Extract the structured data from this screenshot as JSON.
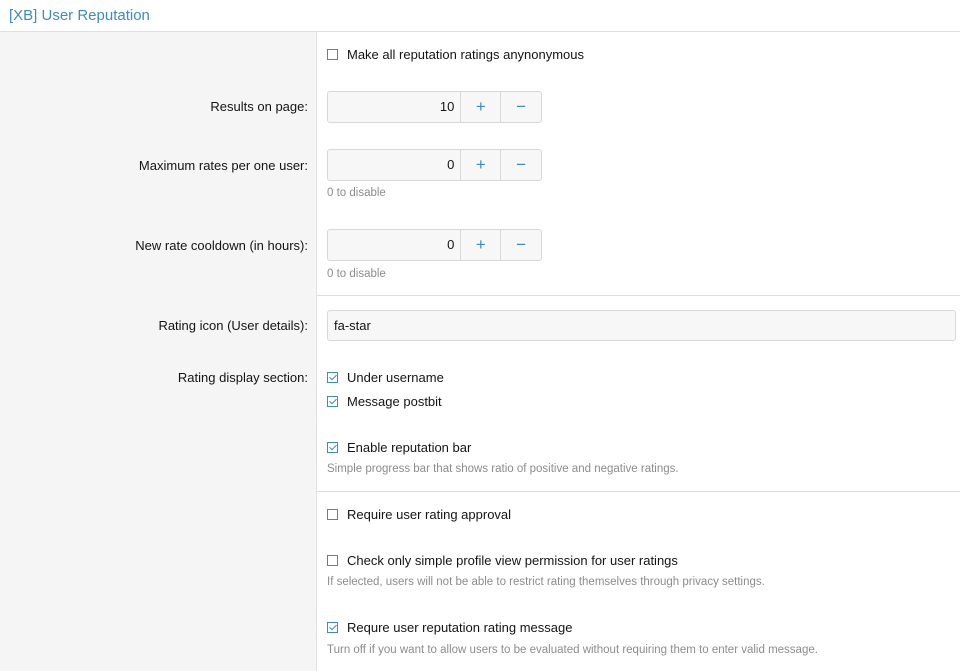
{
  "header": {
    "title": "[XB] User Reputation"
  },
  "options": {
    "anonymous": {
      "label": "Make all reputation ratings anynonymous",
      "checked": false
    },
    "results_on_page": {
      "label": "Results on page:",
      "value": "10",
      "plus": "+",
      "minus": "−"
    },
    "max_rates": {
      "label": "Maximum rates per one user:",
      "value": "0",
      "plus": "+",
      "minus": "−",
      "hint": "0 to disable"
    },
    "cooldown": {
      "label": "New rate cooldown (in hours):",
      "value": "0",
      "plus": "+",
      "minus": "−",
      "hint": "0 to disable"
    },
    "rating_icon": {
      "label": "Rating icon (User details):",
      "value": "fa-star"
    },
    "display_section": {
      "label": "Rating display section:",
      "under_username": {
        "label": "Under username",
        "checked": true
      },
      "message_postbit": {
        "label": "Message postbit",
        "checked": true
      }
    },
    "reputation_bar": {
      "label": "Enable reputation bar",
      "checked": true,
      "hint": "Simple progress bar that shows ratio of positive and negative ratings."
    },
    "require_approval": {
      "label": "Require user rating approval",
      "checked": false
    },
    "simple_profile": {
      "label": "Check only simple profile view permission for user ratings",
      "checked": false,
      "hint": "If selected, users will not be able to restrict rating themselves through privacy settings."
    },
    "require_message": {
      "label": "Requre user reputation rating message",
      "checked": true,
      "hint": "Turn off if you want to allow users to be evaluated without requiring them to enter valid message."
    }
  },
  "colors": {
    "accent": "#3b8bc8",
    "left_bg": "#f5f5f5",
    "hint": "#8c8c8c"
  }
}
